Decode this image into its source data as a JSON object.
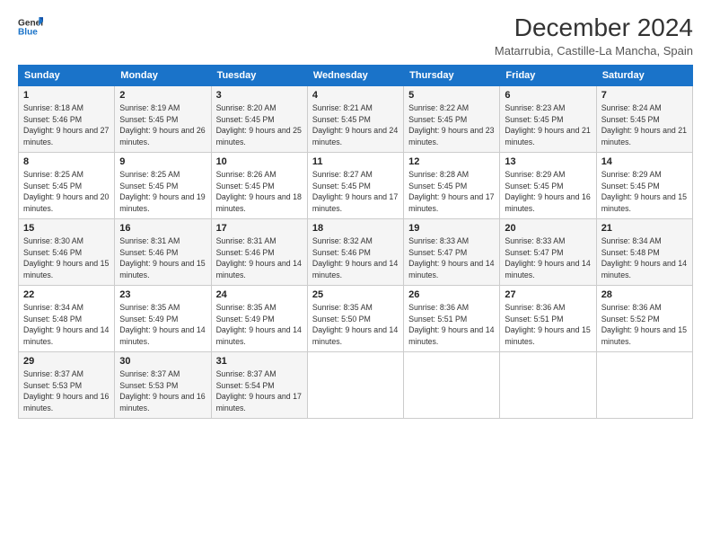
{
  "logo": {
    "line1": "General",
    "line2": "Blue"
  },
  "title": "December 2024",
  "location": "Matarrubia, Castille-La Mancha, Spain",
  "days_of_week": [
    "Sunday",
    "Monday",
    "Tuesday",
    "Wednesday",
    "Thursday",
    "Friday",
    "Saturday"
  ],
  "weeks": [
    [
      {
        "day": "1",
        "info": "Sunrise: 8:18 AM\nSunset: 5:46 PM\nDaylight: 9 hours and 27 minutes."
      },
      {
        "day": "2",
        "info": "Sunrise: 8:19 AM\nSunset: 5:45 PM\nDaylight: 9 hours and 26 minutes."
      },
      {
        "day": "3",
        "info": "Sunrise: 8:20 AM\nSunset: 5:45 PM\nDaylight: 9 hours and 25 minutes."
      },
      {
        "day": "4",
        "info": "Sunrise: 8:21 AM\nSunset: 5:45 PM\nDaylight: 9 hours and 24 minutes."
      },
      {
        "day": "5",
        "info": "Sunrise: 8:22 AM\nSunset: 5:45 PM\nDaylight: 9 hours and 23 minutes."
      },
      {
        "day": "6",
        "info": "Sunrise: 8:23 AM\nSunset: 5:45 PM\nDaylight: 9 hours and 21 minutes."
      },
      {
        "day": "7",
        "info": "Sunrise: 8:24 AM\nSunset: 5:45 PM\nDaylight: 9 hours and 21 minutes."
      }
    ],
    [
      {
        "day": "8",
        "info": "Sunrise: 8:25 AM\nSunset: 5:45 PM\nDaylight: 9 hours and 20 minutes."
      },
      {
        "day": "9",
        "info": "Sunrise: 8:25 AM\nSunset: 5:45 PM\nDaylight: 9 hours and 19 minutes."
      },
      {
        "day": "10",
        "info": "Sunrise: 8:26 AM\nSunset: 5:45 PM\nDaylight: 9 hours and 18 minutes."
      },
      {
        "day": "11",
        "info": "Sunrise: 8:27 AM\nSunset: 5:45 PM\nDaylight: 9 hours and 17 minutes."
      },
      {
        "day": "12",
        "info": "Sunrise: 8:28 AM\nSunset: 5:45 PM\nDaylight: 9 hours and 17 minutes."
      },
      {
        "day": "13",
        "info": "Sunrise: 8:29 AM\nSunset: 5:45 PM\nDaylight: 9 hours and 16 minutes."
      },
      {
        "day": "14",
        "info": "Sunrise: 8:29 AM\nSunset: 5:45 PM\nDaylight: 9 hours and 15 minutes."
      }
    ],
    [
      {
        "day": "15",
        "info": "Sunrise: 8:30 AM\nSunset: 5:46 PM\nDaylight: 9 hours and 15 minutes."
      },
      {
        "day": "16",
        "info": "Sunrise: 8:31 AM\nSunset: 5:46 PM\nDaylight: 9 hours and 15 minutes."
      },
      {
        "day": "17",
        "info": "Sunrise: 8:31 AM\nSunset: 5:46 PM\nDaylight: 9 hours and 14 minutes."
      },
      {
        "day": "18",
        "info": "Sunrise: 8:32 AM\nSunset: 5:46 PM\nDaylight: 9 hours and 14 minutes."
      },
      {
        "day": "19",
        "info": "Sunrise: 8:33 AM\nSunset: 5:47 PM\nDaylight: 9 hours and 14 minutes."
      },
      {
        "day": "20",
        "info": "Sunrise: 8:33 AM\nSunset: 5:47 PM\nDaylight: 9 hours and 14 minutes."
      },
      {
        "day": "21",
        "info": "Sunrise: 8:34 AM\nSunset: 5:48 PM\nDaylight: 9 hours and 14 minutes."
      }
    ],
    [
      {
        "day": "22",
        "info": "Sunrise: 8:34 AM\nSunset: 5:48 PM\nDaylight: 9 hours and 14 minutes."
      },
      {
        "day": "23",
        "info": "Sunrise: 8:35 AM\nSunset: 5:49 PM\nDaylight: 9 hours and 14 minutes."
      },
      {
        "day": "24",
        "info": "Sunrise: 8:35 AM\nSunset: 5:49 PM\nDaylight: 9 hours and 14 minutes."
      },
      {
        "day": "25",
        "info": "Sunrise: 8:35 AM\nSunset: 5:50 PM\nDaylight: 9 hours and 14 minutes."
      },
      {
        "day": "26",
        "info": "Sunrise: 8:36 AM\nSunset: 5:51 PM\nDaylight: 9 hours and 14 minutes."
      },
      {
        "day": "27",
        "info": "Sunrise: 8:36 AM\nSunset: 5:51 PM\nDaylight: 9 hours and 15 minutes."
      },
      {
        "day": "28",
        "info": "Sunrise: 8:36 AM\nSunset: 5:52 PM\nDaylight: 9 hours and 15 minutes."
      }
    ],
    [
      {
        "day": "29",
        "info": "Sunrise: 8:37 AM\nSunset: 5:53 PM\nDaylight: 9 hours and 16 minutes."
      },
      {
        "day": "30",
        "info": "Sunrise: 8:37 AM\nSunset: 5:53 PM\nDaylight: 9 hours and 16 minutes."
      },
      {
        "day": "31",
        "info": "Sunrise: 8:37 AM\nSunset: 5:54 PM\nDaylight: 9 hours and 17 minutes."
      },
      null,
      null,
      null,
      null
    ]
  ]
}
